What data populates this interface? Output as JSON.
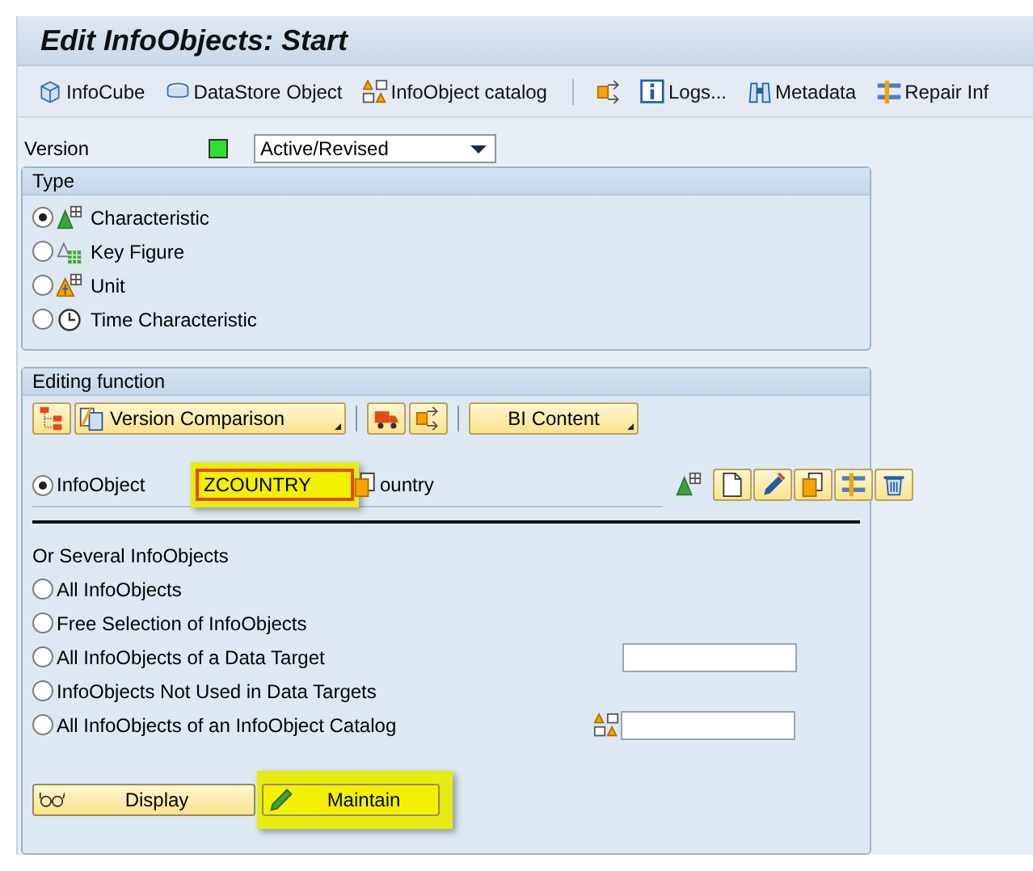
{
  "window": {
    "title": "Edit InfoObjects: Start"
  },
  "toolbar": [
    {
      "kind": "button",
      "label": "InfoCube"
    },
    {
      "kind": "button",
      "label": "DataStore Object"
    },
    {
      "kind": "button",
      "label": "InfoObject catalog"
    },
    {
      "kind": "separator"
    },
    {
      "kind": "icon"
    },
    {
      "kind": "button",
      "label": "Logs..."
    },
    {
      "kind": "button",
      "label": "Metadata"
    },
    {
      "kind": "button",
      "label": "Repair Inf"
    }
  ],
  "version": {
    "label": "Version",
    "value": "Active/Revised"
  },
  "type_panel": {
    "title": "Type",
    "options": [
      {
        "label": "Characteristic",
        "selected": true
      },
      {
        "label": "Key Figure",
        "selected": false
      },
      {
        "label": "Unit",
        "selected": false
      },
      {
        "label": "Time Characteristic",
        "selected": false
      }
    ]
  },
  "editing_panel": {
    "title": "Editing function",
    "toolbar": [
      {
        "kind": "icon"
      },
      {
        "kind": "dropdown",
        "label": "Version Comparison"
      },
      {
        "kind": "separator"
      },
      {
        "kind": "icon"
      },
      {
        "kind": "icon"
      },
      {
        "kind": "separator"
      },
      {
        "kind": "dropdown",
        "label": "BI Content"
      }
    ],
    "infoobject": {
      "label": "InfoObject",
      "selected": true,
      "value": "ZCOUNTRY",
      "highlighted": true,
      "description": "ountry"
    },
    "several_title": "Or Several InfoObjects",
    "options": [
      {
        "kind": "plain",
        "label": "All InfoObjects",
        "selected": false
      },
      {
        "kind": "plain",
        "label": "Free Selection of InfoObjects",
        "selected": false
      },
      {
        "kind": "field",
        "label": "All InfoObjects of a Data Target",
        "selected": false
      },
      {
        "kind": "plain",
        "label": "InfoObjects Not Used in Data Targets",
        "selected": false
      },
      {
        "kind": "catalog_field",
        "label": "All InfoObjects of an InfoObject Catalog",
        "selected": false
      }
    ],
    "buttons": [
      {
        "label": "Display",
        "highlighted": false
      },
      {
        "label": "Maintain",
        "highlighted": true
      }
    ]
  }
}
